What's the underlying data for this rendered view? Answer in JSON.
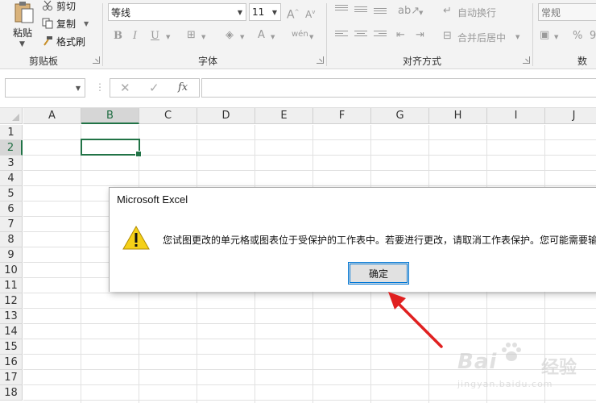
{
  "ribbon": {
    "clipboard": {
      "paste_label": "粘贴",
      "cut_label": "剪切",
      "copy_label": "复制",
      "format_painter_label": "格式刷",
      "group_label": "剪贴板"
    },
    "font": {
      "font_name": "等线",
      "font_size": "11",
      "group_label": "字体"
    },
    "alignment": {
      "wrap_text_label": "自动换行",
      "merge_center_label": "合并后居中",
      "group_label": "对齐方式"
    },
    "number": {
      "format": "常规",
      "group_label": "数字"
    }
  },
  "formula_bar": {
    "fx_label": "fx",
    "cancel_glyph": "✕",
    "enter_glyph": "✓"
  },
  "grid": {
    "columns": [
      "A",
      "B",
      "C",
      "D",
      "E",
      "F",
      "G",
      "H",
      "I",
      "J"
    ],
    "rows": [
      "1",
      "2",
      "3",
      "4",
      "5",
      "6",
      "7",
      "8",
      "9",
      "10",
      "11",
      "12",
      "13",
      "14",
      "15",
      "16",
      "17",
      "18"
    ],
    "selected_column": "B",
    "selected_row": "2"
  },
  "dialog": {
    "title": "Microsoft Excel",
    "message": "您试图更改的单元格或图表位于受保护的工作表中。若要进行更改，请取消工作表保护。您可能需要输",
    "ok_label": "确定"
  },
  "watermark": {
    "brand": "Bai",
    "brand_cn": "经验",
    "url": "jingyan.baidu.com"
  },
  "colors": {
    "excel_green": "#217346",
    "focus_blue": "#0078d7",
    "annotation_red": "#e02020",
    "warning_yellow": "#f5d018"
  }
}
